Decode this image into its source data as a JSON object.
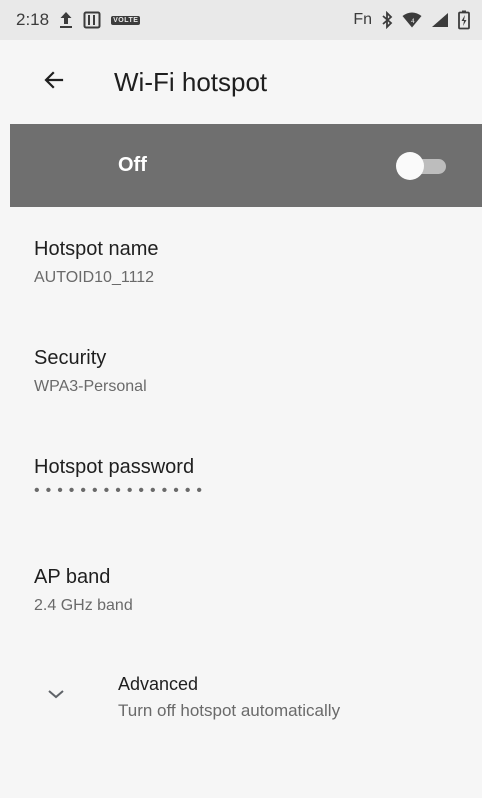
{
  "status_bar": {
    "time": "2:18",
    "volte": "VOLTE",
    "fn": "Fn",
    "icons": [
      "upload-icon",
      "storage-icon",
      "volte-icon",
      "bluetooth-icon",
      "wifi-icon",
      "signal-icon",
      "battery-icon"
    ]
  },
  "app_bar": {
    "title": "Wi-Fi hotspot",
    "back_icon": "arrow-back-icon"
  },
  "master_switch": {
    "label": "Off",
    "state": "off"
  },
  "preferences": {
    "hotspot_name": {
      "title": "Hotspot name",
      "summary": "AUTOID10_1112"
    },
    "security": {
      "title": "Security",
      "summary": "WPA3-Personal"
    },
    "password": {
      "title": "Hotspot password",
      "summary": "•••••••••••••••"
    },
    "ap_band": {
      "title": "AP band",
      "summary": "2.4 GHz band"
    }
  },
  "advanced": {
    "title": "Advanced",
    "summary": "Turn off hotspot automatically",
    "icon": "chevron-down-icon"
  },
  "colors": {
    "switch_bar_bg": "#6f6f6f",
    "status_bar_bg": "#e9e9e9",
    "page_bg": "#f6f6f6"
  }
}
